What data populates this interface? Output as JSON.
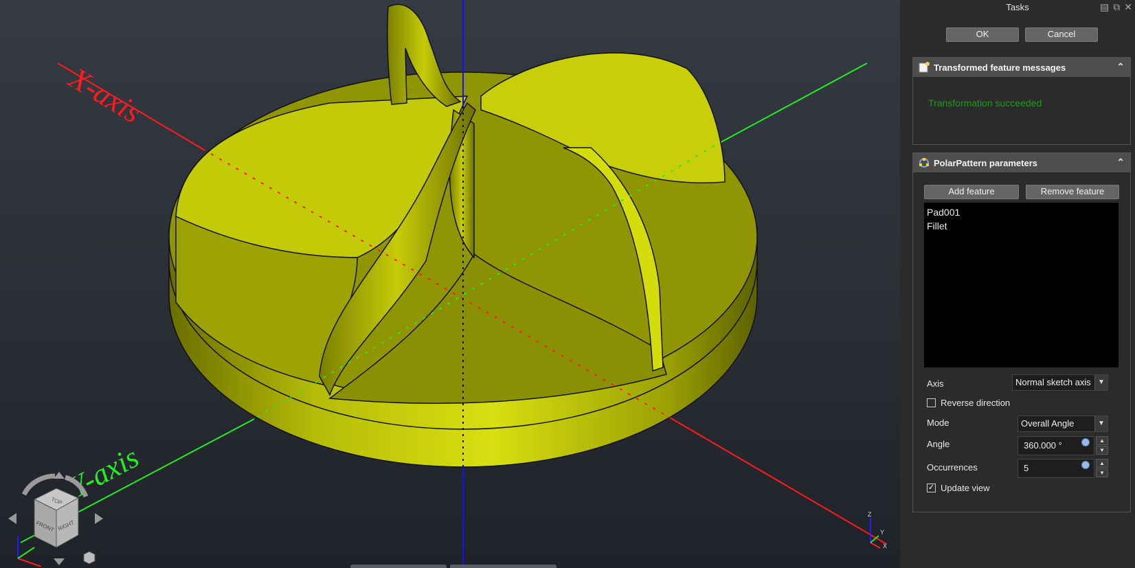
{
  "viewport": {
    "x_axis_label": "X-axis",
    "y_axis_label": "Y-axis",
    "navcube": {
      "top": "TOP",
      "front": "FRONT",
      "right": "RIGHT"
    },
    "mini_axes": {
      "z": "Z",
      "y": "Y",
      "x": "X"
    },
    "colors": {
      "model": "#c8cf0a",
      "x_axis": "#ff1b1b",
      "y_axis": "#22ee22",
      "z_axis": "#1010ff"
    }
  },
  "tasks": {
    "title": "Tasks",
    "ok_label": "OK",
    "cancel_label": "Cancel",
    "messages_panel": {
      "title": "Transformed feature messages",
      "message": "Transformation succeeded"
    },
    "params_panel": {
      "title": "PolarPattern parameters",
      "add_feature_label": "Add feature",
      "remove_feature_label": "Remove feature",
      "features": [
        "Pad001",
        "Fillet"
      ],
      "axis_label": "Axis",
      "axis_value": "Normal sketch axis",
      "reverse_label": "Reverse direction",
      "reverse_checked": false,
      "mode_label": "Mode",
      "mode_value": "Overall Angle",
      "angle_label": "Angle",
      "angle_value": "360.000 °",
      "occurrences_label": "Occurrences",
      "occurrences_value": "5",
      "update_label": "Update view",
      "update_checked": true
    }
  }
}
